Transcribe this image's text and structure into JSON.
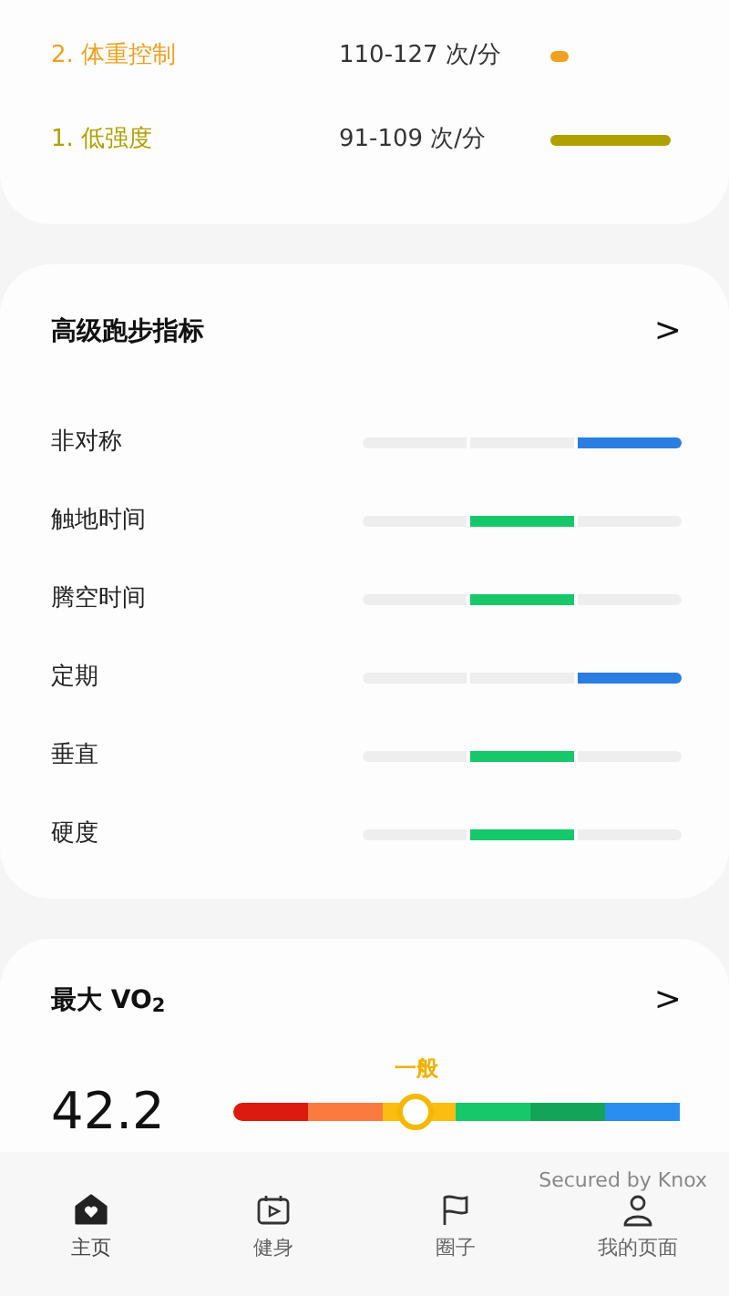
{
  "heart_zones": [
    {
      "label": "2. 体重控制",
      "range": "110-127 次/分",
      "color": "#f0a020"
    },
    {
      "label": "1. 低强度",
      "range": "91-109 次/分",
      "color": "#b0a000"
    }
  ],
  "running_metrics": {
    "title": "高级跑步指标",
    "chevron": ">",
    "items": [
      {
        "name": "非对称",
        "color": "#2a7de1",
        "segments": [
          {
            "selected": false
          },
          {
            "selected": false
          },
          {
            "selected": true
          }
        ]
      },
      {
        "name": "触地时间",
        "color": "#16c86a",
        "segments": [
          {
            "selected": false
          },
          {
            "selected": true
          },
          {
            "selected": false
          }
        ]
      },
      {
        "name": "腾空时间",
        "color": "#16c86a",
        "segments": [
          {
            "selected": false
          },
          {
            "selected": true
          },
          {
            "selected": false
          }
        ]
      },
      {
        "name": "定期",
        "color": "#2a7de1",
        "segments": [
          {
            "selected": false
          },
          {
            "selected": false
          },
          {
            "selected": true
          }
        ]
      },
      {
        "name": "垂直",
        "color": "#16c86a",
        "segments": [
          {
            "selected": false
          },
          {
            "selected": true
          },
          {
            "selected": false
          }
        ]
      },
      {
        "name": "硬度",
        "color": "#16c86a",
        "segments": [
          {
            "selected": false
          },
          {
            "selected": true
          },
          {
            "selected": false
          }
        ]
      }
    ]
  },
  "vo2max": {
    "title": "最大 VO$_{2}$",
    "chevron": ">",
    "value": "42.2",
    "rating": "一般",
    "level": 0.41,
    "scale": [
      {
        "color": "#dd1a0e"
      },
      {
        "color": "#fb7a40"
      },
      {
        "color": "#fbbd10"
      },
      {
        "color": "#16c86a"
      },
      {
        "color": "#12a55a"
      },
      {
        "color": "#2a8df0"
      }
    ]
  },
  "footer_note": "Secured by Knox",
  "nav": [
    {
      "label": "主页",
      "selected": true
    },
    {
      "label": "健身",
      "selected": false
    },
    {
      "label": "圈子",
      "selected": false
    },
    {
      "label": "我的页面",
      "selected": false
    }
  ]
}
